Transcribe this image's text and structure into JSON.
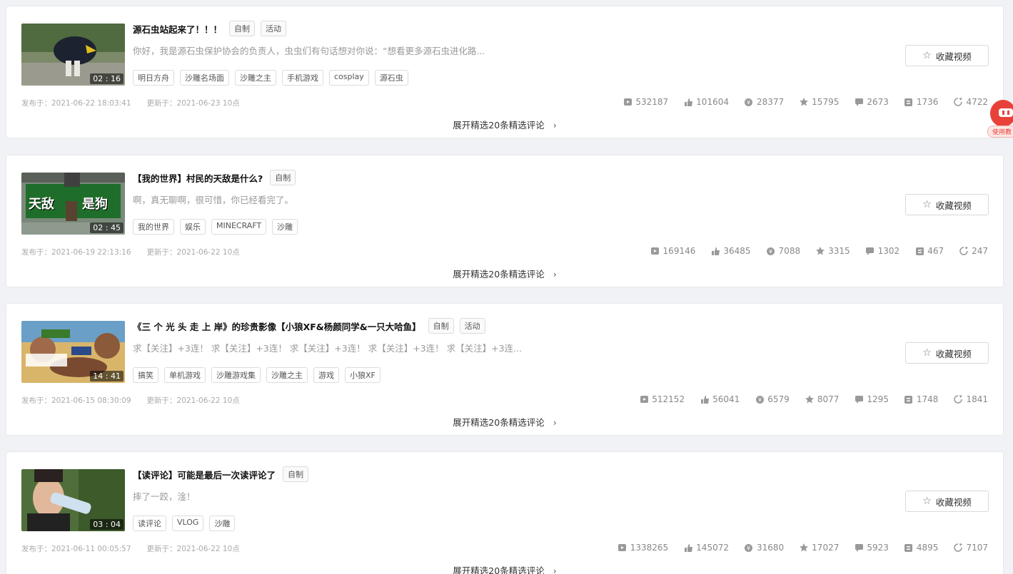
{
  "labels": {
    "published_prefix": "发布于：",
    "updated_prefix": "更新于：",
    "favorite_button": "收藏视频",
    "expand_comments": "展开精选20条精选评论"
  },
  "helper_label": "使用教",
  "videos": [
    {
      "title": "源石虫站起来了！！！",
      "badges": [
        "自制",
        "活动"
      ],
      "description": "你好，我是源石虫保护协会的负责人，虫虫们有句话想对你说：“想看更多源石虫进化路...",
      "tags": [
        "明日方舟",
        "沙雕名场面",
        "沙雕之主",
        "手机游戏",
        "cosplay",
        "源石虫"
      ],
      "duration": "02 : 16",
      "published": "2021-06-22 18:03:41",
      "updated": "2021-06-23 10点",
      "stats": {
        "views": "532187",
        "likes": "101604",
        "coins": "28377",
        "favorites": "15795",
        "danmaku": "2673",
        "comments": "1736",
        "shares": "4722"
      }
    },
    {
      "title": "【我的世界】村民的天敌是什么?",
      "badges": [
        "自制"
      ],
      "description": "啊，真无聊啊，很可惜，你已经看完了。",
      "tags": [
        "我的世界",
        "娱乐",
        "MINECRAFT",
        "沙雕"
      ],
      "duration": "02 : 45",
      "thumb_text": [
        "天敌",
        "是狗"
      ],
      "published": "2021-06-19 22:13:16",
      "updated": "2021-06-22 10点",
      "stats": {
        "views": "169146",
        "likes": "36485",
        "coins": "7088",
        "favorites": "3315",
        "danmaku": "1302",
        "comments": "467",
        "shares": "247"
      }
    },
    {
      "title": "《三 个 光 头 走 上 岸》的珍贵影像【小狼XF&杨颜同学&一只大哈鱼】",
      "badges": [
        "自制",
        "活动"
      ],
      "description": "求【关注】+3连！ 求【关注】+3连！ 求【关注】+3连！ 求【关注】+3连！ 求【关注】+3连...",
      "tags": [
        "搞笑",
        "单机游戏",
        "沙雕游戏集",
        "沙雕之主",
        "游戏",
        "小狼XF"
      ],
      "duration": "14 : 41",
      "published": "2021-06-15 08:30:09",
      "updated": "2021-06-22 10点",
      "stats": {
        "views": "512152",
        "likes": "56041",
        "coins": "6579",
        "favorites": "8077",
        "danmaku": "1295",
        "comments": "1748",
        "shares": "1841"
      }
    },
    {
      "title": "【读评论】可能是最后一次读评论了",
      "badges": [
        "自制"
      ],
      "description": "摔了一跤，淦！",
      "tags": [
        "读评论",
        "VLOG",
        "沙雕"
      ],
      "duration": "03 : 04",
      "published": "2021-06-11 00:05:57",
      "updated": "2021-06-22 10点",
      "stats": {
        "views": "1338265",
        "likes": "145072",
        "coins": "31680",
        "favorites": "17027",
        "danmaku": "5923",
        "comments": "4895",
        "shares": "7107"
      }
    }
  ]
}
